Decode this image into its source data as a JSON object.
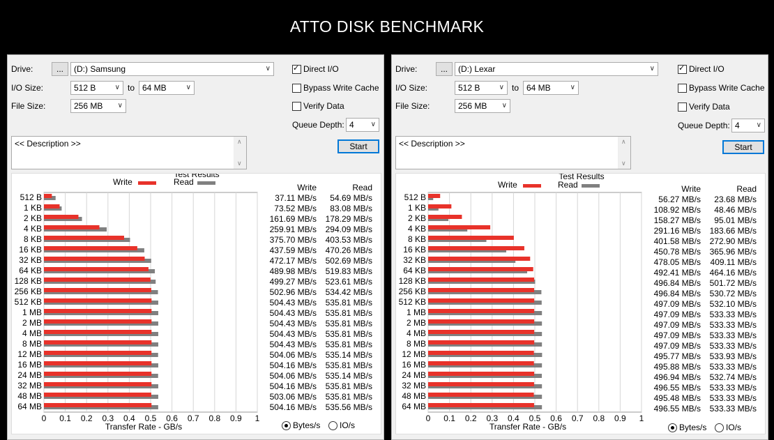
{
  "title": "ATTO DISK BENCHMARK",
  "colors": {
    "write": "#e8322a",
    "read": "#808080"
  },
  "panels": [
    {
      "drive_label": "Drive:",
      "browse_label": "...",
      "drive_value": "(D:) Samsung",
      "io_size_label": "I/O Size:",
      "io_from": "512 B",
      "to_label": "to",
      "io_to": "64 MB",
      "file_size_label": "File Size:",
      "file_size": "256 MB",
      "direct_io_label": "Direct I/O",
      "direct_io_checked": true,
      "bypass_label": "Bypass Write Cache",
      "bypass_checked": false,
      "verify_label": "Verify Data",
      "verify_checked": false,
      "queue_label": "Queue Depth:",
      "queue_value": "4",
      "description": "<< Description >>",
      "start_label": "Start",
      "results_title": "Test Results",
      "legend_write": "Write",
      "legend_read": "Read",
      "col_write": "Write",
      "col_read": "Read",
      "axis_label": "Transfer Rate - GB/s",
      "radio_bytes": "Bytes/s",
      "radio_io": "IO/s",
      "bytes_selected": true,
      "sizes": [
        "512 B",
        "1 KB",
        "2 KB",
        "4 KB",
        "8 KB",
        "16 KB",
        "32 KB",
        "64 KB",
        "128 KB",
        "256 KB",
        "512 KB",
        "1 MB",
        "2 MB",
        "4 MB",
        "8 MB",
        "12 MB",
        "16 MB",
        "24 MB",
        "32 MB",
        "48 MB",
        "64 MB"
      ],
      "write_text": [
        "37.11 MB/s",
        "73.52 MB/s",
        "161.69 MB/s",
        "259.91 MB/s",
        "375.70 MB/s",
        "437.59 MB/s",
        "472.17 MB/s",
        "489.98 MB/s",
        "499.27 MB/s",
        "502.96 MB/s",
        "504.43 MB/s",
        "504.43 MB/s",
        "504.43 MB/s",
        "504.43 MB/s",
        "504.43 MB/s",
        "504.06 MB/s",
        "504.16 MB/s",
        "504.06 MB/s",
        "504.16 MB/s",
        "503.06 MB/s",
        "504.16 MB/s"
      ],
      "read_text": [
        "54.69 MB/s",
        "83.08 MB/s",
        "178.29 MB/s",
        "294.09 MB/s",
        "403.53 MB/s",
        "470.26 MB/s",
        "502.69 MB/s",
        "519.83 MB/s",
        "523.61 MB/s",
        "534.42 MB/s",
        "535.81 MB/s",
        "535.81 MB/s",
        "535.81 MB/s",
        "535.81 MB/s",
        "535.81 MB/s",
        "535.14 MB/s",
        "535.81 MB/s",
        "535.14 MB/s",
        "535.81 MB/s",
        "535.81 MB/s",
        "535.56 MB/s"
      ],
      "chart_data": {
        "type": "bar",
        "orientation": "horizontal",
        "title": "Test Results",
        "xlabel": "Transfer Rate - GB/s",
        "xlim": [
          0,
          1
        ],
        "x_ticks": [
          "0",
          "0.1",
          "0.2",
          "0.3",
          "0.4",
          "0.5",
          "0.6",
          "0.7",
          "0.8",
          "0.9",
          "1"
        ],
        "categories": [
          "512 B",
          "1 KB",
          "2 KB",
          "4 KB",
          "8 KB",
          "16 KB",
          "32 KB",
          "64 KB",
          "128 KB",
          "256 KB",
          "512 KB",
          "1 MB",
          "2 MB",
          "4 MB",
          "8 MB",
          "12 MB",
          "16 MB",
          "24 MB",
          "32 MB",
          "48 MB",
          "64 MB"
        ],
        "series": [
          {
            "name": "Write",
            "values": [
              0.03711,
              0.07352,
              0.16169,
              0.25991,
              0.3757,
              0.43759,
              0.47217,
              0.48998,
              0.49927,
              0.50296,
              0.50443,
              0.50443,
              0.50443,
              0.50443,
              0.50443,
              0.50406,
              0.50416,
              0.50406,
              0.50416,
              0.50306,
              0.50416
            ]
          },
          {
            "name": "Read",
            "values": [
              0.05469,
              0.08308,
              0.17829,
              0.29409,
              0.40353,
              0.47026,
              0.50269,
              0.51983,
              0.52361,
              0.53442,
              0.53581,
              0.53581,
              0.53581,
              0.53581,
              0.53581,
              0.53514,
              0.53581,
              0.53514,
              0.53581,
              0.53581,
              0.53556
            ]
          }
        ]
      }
    },
    {
      "drive_label": "Drive:",
      "browse_label": "...",
      "drive_value": "(D:) Lexar",
      "io_size_label": "I/O Size:",
      "io_from": "512 B",
      "to_label": "to",
      "io_to": "64 MB",
      "file_size_label": "File Size:",
      "file_size": "256 MB",
      "direct_io_label": "Direct I/O",
      "direct_io_checked": true,
      "bypass_label": "Bypass Write Cache",
      "bypass_checked": false,
      "verify_label": "Verify Data",
      "verify_checked": false,
      "queue_label": "Queue Depth:",
      "queue_value": "4",
      "description": "<< Description >>",
      "start_label": "Start",
      "results_title": "Test Results",
      "legend_write": "Write",
      "legend_read": "Read",
      "col_write": "Write",
      "col_read": "Read",
      "axis_label": "Transfer Rate - GB/s",
      "radio_bytes": "Bytes/s",
      "radio_io": "IO/s",
      "bytes_selected": true,
      "sizes": [
        "512 B",
        "1 KB",
        "2 KB",
        "4 KB",
        "8 KB",
        "16 KB",
        "32 KB",
        "64 KB",
        "128 KB",
        "256 KB",
        "512 KB",
        "1 MB",
        "2 MB",
        "4 MB",
        "8 MB",
        "12 MB",
        "16 MB",
        "24 MB",
        "32 MB",
        "48 MB",
        "64 MB"
      ],
      "write_text": [
        "56.27 MB/s",
        "108.92 MB/s",
        "158.27 MB/s",
        "291.16 MB/s",
        "401.58 MB/s",
        "450.78 MB/s",
        "478.05 MB/s",
        "492.41 MB/s",
        "496.84 MB/s",
        "496.84 MB/s",
        "497.09 MB/s",
        "497.09 MB/s",
        "497.09 MB/s",
        "497.09 MB/s",
        "497.09 MB/s",
        "495.77 MB/s",
        "495.88 MB/s",
        "496.94 MB/s",
        "496.55 MB/s",
        "495.48 MB/s",
        "496.55 MB/s"
      ],
      "read_text": [
        "23.68 MB/s",
        "48.46 MB/s",
        "95.01 MB/s",
        "183.66 MB/s",
        "272.90 MB/s",
        "365.96 MB/s",
        "409.11 MB/s",
        "464.16 MB/s",
        "501.72 MB/s",
        "530.72 MB/s",
        "532.10 MB/s",
        "533.33 MB/s",
        "533.33 MB/s",
        "533.33 MB/s",
        "533.33 MB/s",
        "533.93 MB/s",
        "533.33 MB/s",
        "532.74 MB/s",
        "533.33 MB/s",
        "533.33 MB/s",
        "533.33 MB/s"
      ],
      "chart_data": {
        "type": "bar",
        "orientation": "horizontal",
        "title": "Test Results",
        "xlabel": "Transfer Rate - GB/s",
        "xlim": [
          0,
          1
        ],
        "x_ticks": [
          "0",
          "0.1",
          "0.2",
          "0.3",
          "0.4",
          "0.5",
          "0.6",
          "0.7",
          "0.8",
          "0.9",
          "1"
        ],
        "categories": [
          "512 B",
          "1 KB",
          "2 KB",
          "4 KB",
          "8 KB",
          "16 KB",
          "32 KB",
          "64 KB",
          "128 KB",
          "256 KB",
          "512 KB",
          "1 MB",
          "2 MB",
          "4 MB",
          "8 MB",
          "12 MB",
          "16 MB",
          "24 MB",
          "32 MB",
          "48 MB",
          "64 MB"
        ],
        "series": [
          {
            "name": "Write",
            "values": [
              0.05627,
              0.10892,
              0.15827,
              0.29116,
              0.40158,
              0.45078,
              0.47805,
              0.49241,
              0.49684,
              0.49684,
              0.49709,
              0.49709,
              0.49709,
              0.49709,
              0.49709,
              0.49577,
              0.49588,
              0.49694,
              0.49655,
              0.49548,
              0.49655
            ]
          },
          {
            "name": "Read",
            "values": [
              0.02368,
              0.04846,
              0.09501,
              0.18366,
              0.2729,
              0.36596,
              0.40911,
              0.46416,
              0.50172,
              0.53072,
              0.5321,
              0.53333,
              0.53333,
              0.53333,
              0.53333,
              0.53393,
              0.53333,
              0.53274,
              0.53333,
              0.53333,
              0.53333
            ]
          }
        ]
      }
    }
  ]
}
